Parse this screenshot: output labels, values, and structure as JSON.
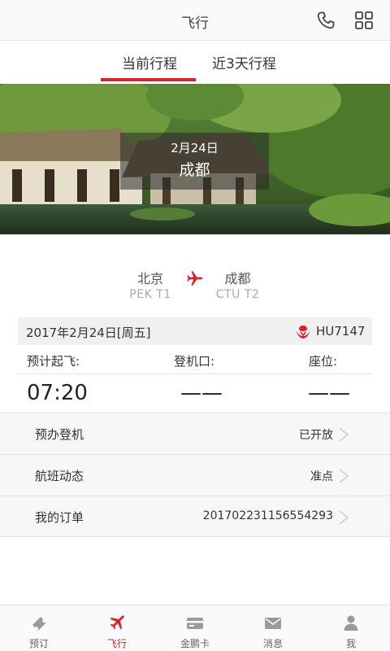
{
  "header": {
    "title": "飞行"
  },
  "tabs": [
    {
      "label": "当前行程",
      "active": true
    },
    {
      "label": "近3天行程",
      "active": false
    }
  ],
  "banner": {
    "date": "2月24日",
    "city": "成都"
  },
  "route": {
    "from": {
      "city": "北京",
      "code": "PEK T1"
    },
    "to": {
      "city": "成都",
      "code": "CTU T2"
    }
  },
  "flight": {
    "date": "2017年2月24日[周五]",
    "number": "HU7147",
    "labels": {
      "departure": "预计起飞:",
      "gate": "登机口:",
      "seat": "座位:"
    },
    "values": {
      "departure": "07:20",
      "gate": "——",
      "seat": "——"
    }
  },
  "rows": [
    {
      "label": "预办登机",
      "value": "已开放"
    },
    {
      "label": "航班动态",
      "value": "准点"
    },
    {
      "label": "我的订单",
      "value": "201702231156554293"
    }
  ],
  "nav": [
    {
      "label": "预订",
      "icon": "ticket-icon",
      "active": false
    },
    {
      "label": "飞行",
      "icon": "plane-icon",
      "active": true
    },
    {
      "label": "金鹏卡",
      "icon": "card-icon",
      "active": false
    },
    {
      "label": "消息",
      "icon": "mail-icon",
      "active": false
    },
    {
      "label": "我",
      "icon": "person-icon",
      "active": false
    }
  ],
  "colors": {
    "accent": "#d8232a",
    "background": "#ffffff",
    "row_bg": "#f7f7f7"
  }
}
